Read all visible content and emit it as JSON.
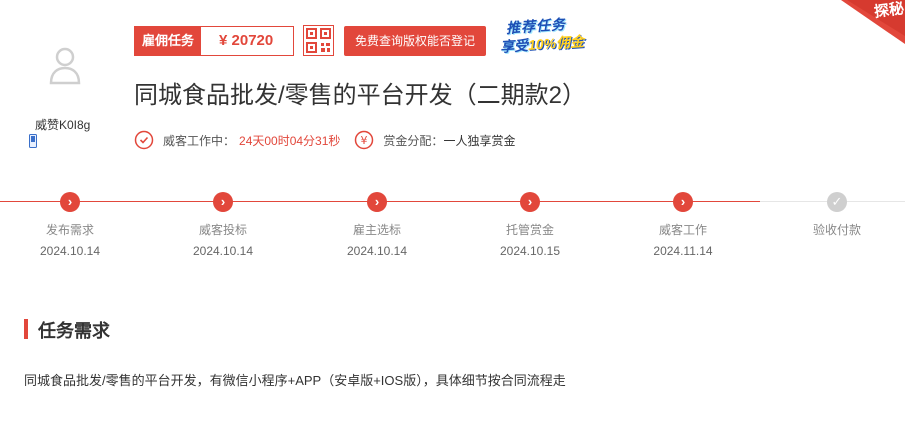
{
  "user": {
    "name": "威赞K0I8g"
  },
  "task": {
    "badge_label": "雇佣任务",
    "price": "¥ 20720",
    "check_button": "免费查询版权能否登记",
    "promo_line1": "推荐任务",
    "promo_line2_prefix": "享受",
    "promo_line2_highlight": "10%佣金",
    "corner_text": "探秘",
    "title": "同城食品批发/零售的平台开发（二期款2）"
  },
  "meta": {
    "work_label": "威客工作中：",
    "work_time": "24天00时04分31秒",
    "reward_icon_glyph": "¥",
    "reward_label": "赏金分配：",
    "reward_value": "一人独享赏金"
  },
  "progress": {
    "steps": [
      {
        "label": "发布需求",
        "date": "2024.10.14",
        "done": true
      },
      {
        "label": "威客投标",
        "date": "2024.10.14",
        "done": true
      },
      {
        "label": "雇主选标",
        "date": "2024.10.14",
        "done": true
      },
      {
        "label": "托管赏金",
        "date": "2024.10.15",
        "done": true
      },
      {
        "label": "威客工作",
        "date": "2024.11.14",
        "done": true
      },
      {
        "label": "验收付款",
        "date": "",
        "done": false
      }
    ]
  },
  "section": {
    "title": "任务需求",
    "body": "同城食品批发/零售的平台开发，有微信小程序+APP（安卓版+IOS版），具体细节按合同流程走"
  },
  "colors": {
    "accent": "#e2473b",
    "pending": "#cfcfcf",
    "promo_blue": "#1d4fb5"
  },
  "icons": {
    "avatar": "user-silhouette-icon",
    "phone": "phone-icon",
    "qr": "qr-code-icon",
    "clock": "clock-icon",
    "yen": "yen-icon",
    "step_done": "chevron-right-icon",
    "step_todo": "check-icon"
  }
}
